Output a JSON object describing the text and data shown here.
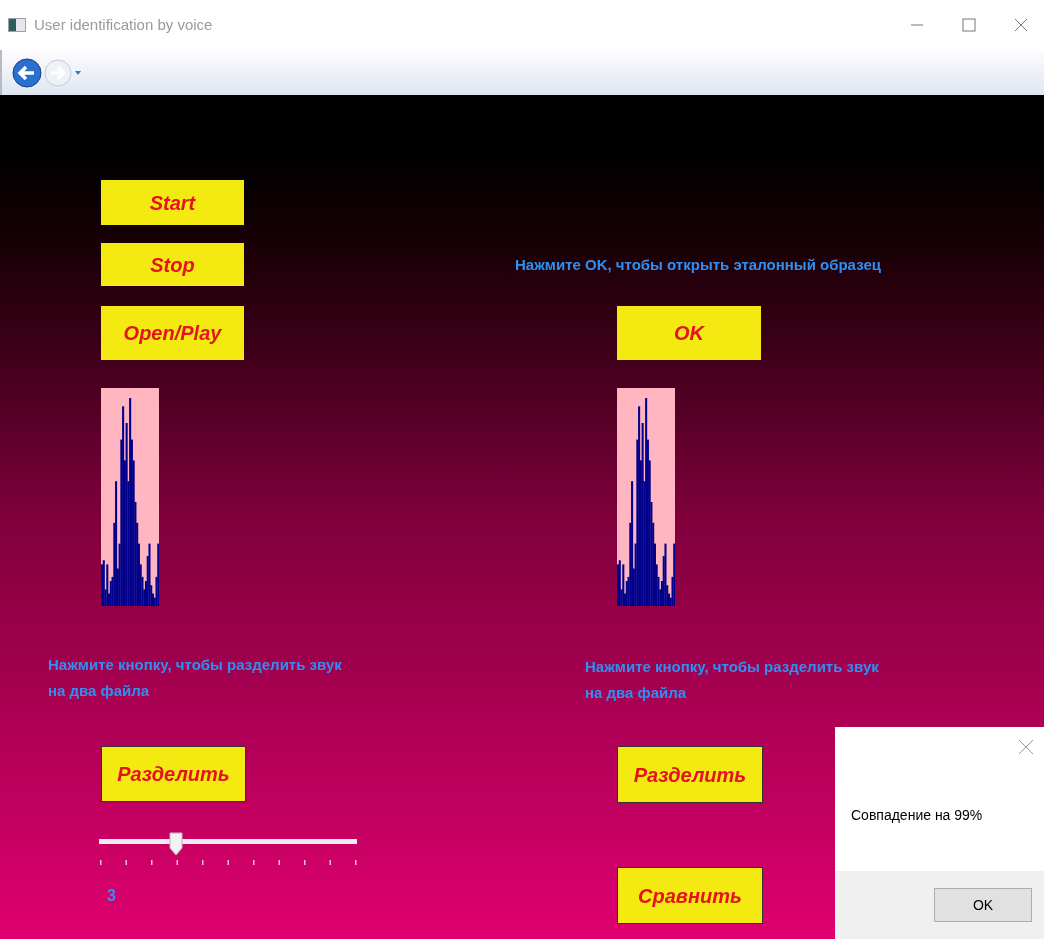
{
  "window": {
    "title": "User identification by voice"
  },
  "left": {
    "buttons": [
      "Start",
      "Stop",
      "Open/Play"
    ],
    "split_hint": "Нажмите кнопку, чтобы разделить звук на два файла",
    "split_button": "Разделить",
    "slider": {
      "level": 0.3,
      "reading": "3"
    }
  },
  "right": {
    "hint": "Нажмите OK, чтобы открыть эталонный образец",
    "ok_button": "OK",
    "split_hint": "Нажмите кнопку, чтобы разделить звук на два файла",
    "split_button": "Разделить",
    "compare_button": "Сравнить"
  },
  "dialog": {
    "message": "Совпадение на 99%",
    "button": "OK"
  }
}
